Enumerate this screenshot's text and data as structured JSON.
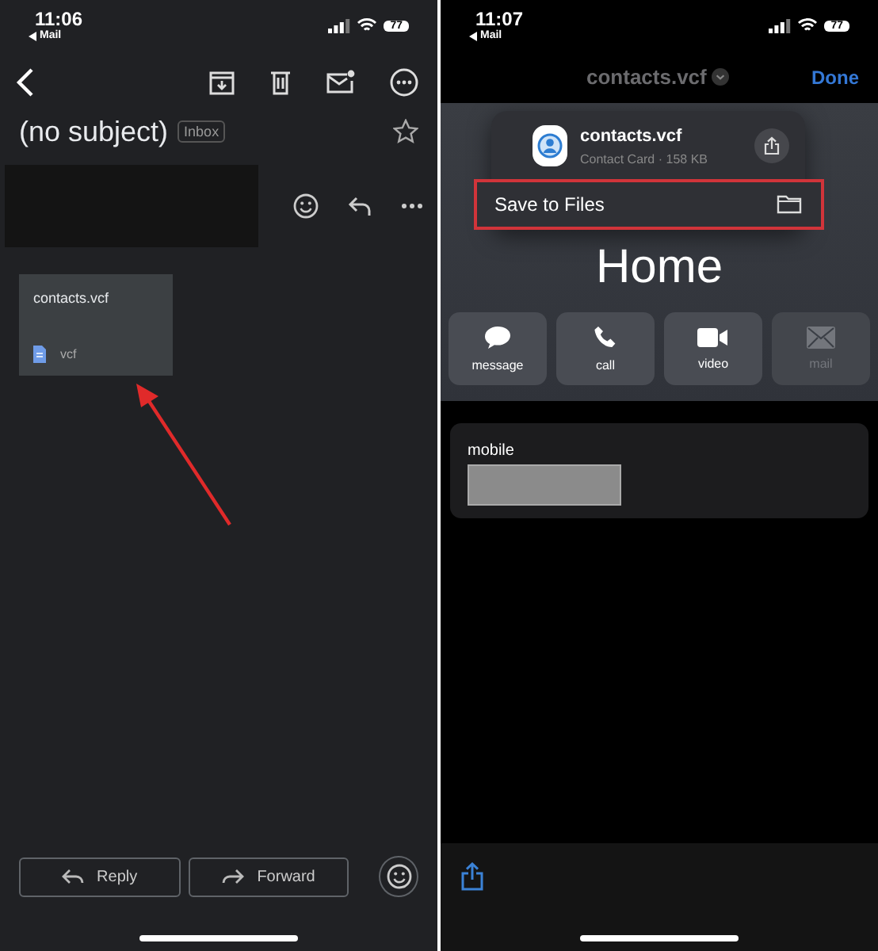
{
  "left": {
    "status": {
      "time": "11:06",
      "back": "Mail",
      "battery": "77"
    },
    "subject": "(no subject)",
    "label": "Inbox",
    "attachment": {
      "name": "contacts.vcf",
      "type": "vcf"
    },
    "buttons": [
      {
        "label": "Reply",
        "kind": "reply"
      },
      {
        "label": "Forward",
        "kind": "forward"
      }
    ]
  },
  "right": {
    "status": {
      "time": "11:07",
      "back": "Mail",
      "battery": "77"
    },
    "title": "contacts.vcf",
    "done": "Done",
    "file": {
      "name": "contacts.vcf",
      "meta": "Contact Card · 158 KB"
    },
    "menu_item": "Save to Files",
    "heading": "Home",
    "actions": [
      {
        "label": "message",
        "kind": "message",
        "disabled": false
      },
      {
        "label": "call",
        "kind": "call",
        "disabled": false
      },
      {
        "label": "video",
        "kind": "video",
        "disabled": false
      },
      {
        "label": "mail",
        "kind": "mail",
        "disabled": true
      }
    ],
    "field": {
      "label": "mobile"
    }
  }
}
